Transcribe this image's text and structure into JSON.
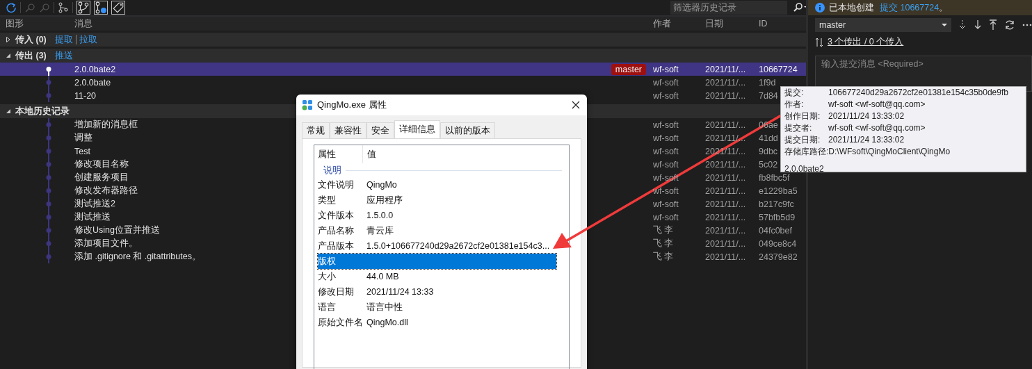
{
  "toolbar": {
    "filter": {
      "placeholder": "筛选器历史记录"
    }
  },
  "columns": [
    "图形",
    "消息",
    "作者",
    "日期",
    "ID"
  ],
  "sections": [
    {
      "title": "传入 (0)",
      "expanded": false,
      "links": [
        "提取",
        "拉取"
      ]
    },
    {
      "title": "传出 (3)",
      "expanded": true,
      "links": [
        "推送"
      ],
      "commits": [
        {
          "message": "2.0.0bate2",
          "branch": "master",
          "author": "wf-soft",
          "date": "2021/11/...",
          "id": "10667724",
          "selected": true
        },
        {
          "message": "2.0.0bate",
          "author": "wf-soft",
          "date": "2021/11/...",
          "id": "1f9d",
          "selected": false
        },
        {
          "message": "11-20",
          "author": "wf-soft",
          "date": "2021/11/...",
          "id": "7d84",
          "selected": false
        }
      ]
    },
    {
      "title": "本地历史记录",
      "expanded": true,
      "commits": [
        {
          "message": "增加新的消息框",
          "author": "wf-soft",
          "date": "2021/11/...",
          "id": "06ae",
          "selected": false
        },
        {
          "message": "调整",
          "author": "wf-soft",
          "date": "2021/11/...",
          "id": "41dd",
          "selected": false
        },
        {
          "message": "Test",
          "author": "wf-soft",
          "date": "2021/11/...",
          "id": "9dbc",
          "selected": false
        },
        {
          "message": "修改项目名称",
          "author": "wf-soft",
          "date": "2021/11/...",
          "id": "5c02",
          "selected": false
        },
        {
          "message": "创建服务项目",
          "author": "wf-soft",
          "date": "2021/11/...",
          "id": "fb8fbc5f",
          "selected": false
        },
        {
          "message": "修改发布器路径",
          "author": "wf-soft",
          "date": "2021/11/...",
          "id": "e1229ba5",
          "selected": false
        },
        {
          "message": "测试推送2",
          "author": "wf-soft",
          "date": "2021/11/...",
          "id": "b217c9fc",
          "selected": false
        },
        {
          "message": "测试推送",
          "author": "wf-soft",
          "date": "2021/11/...",
          "id": "57bfb5d9",
          "selected": false
        },
        {
          "message": "修改Using位置并推送",
          "author": "飞 李",
          "date": "2021/11/...",
          "id": "04fc0bef",
          "selected": false
        },
        {
          "message": "添加项目文件。",
          "author": "飞 李",
          "date": "2021/11/...",
          "id": "049ce8c4",
          "selected": false
        },
        {
          "message": "添加 .gitignore 和 .gitattributes。",
          "author": "飞 李",
          "date": "2021/11/...",
          "id": "24379e82",
          "selected": false
        }
      ]
    }
  ],
  "right_panel": {
    "notice": "已本地创建",
    "notice_link": "提交 10667724",
    "notice_end": "。",
    "branch": "master",
    "sync_link": "3 个传出 / 0 个传入",
    "commit_message": {
      "placeholder": "输入提交消息 <Required>"
    }
  },
  "tooltip": {
    "fields": [
      {
        "label": "提交:",
        "value": "106677240d29a2672cf2e01381e154c35b0de9fb"
      },
      {
        "label": "作者:",
        "value": "wf-soft <wf-soft@qq.com>"
      },
      {
        "label": "创作日期:",
        "value": "2021/11/24 13:33:02"
      },
      {
        "label": "提交者:",
        "value": "wf-soft <wf-soft@qq.com>"
      },
      {
        "label": "提交日期:",
        "value": "2021/11/24 13:33:02"
      },
      {
        "label": "存储库路径:",
        "value": "D:\\WFsoft\\QingMoClient\\QingMo"
      }
    ],
    "message": "2.0.0bate2"
  },
  "dialog": {
    "title": "QingMo.exe 属性",
    "tabs": [
      {
        "label": "常规",
        "selected": false
      },
      {
        "label": "兼容性",
        "selected": false
      },
      {
        "label": "安全",
        "selected": false
      },
      {
        "label": "详细信息",
        "selected": true
      },
      {
        "label": "以前的版本",
        "selected": false
      }
    ],
    "columns": [
      "属性",
      "值"
    ],
    "rows": [
      {
        "kind": "group",
        "name": "说明"
      },
      {
        "kind": "row",
        "name": "文件说明",
        "value": "QingMo",
        "selected": false
      },
      {
        "kind": "row",
        "name": "类型",
        "value": "应用程序",
        "selected": false
      },
      {
        "kind": "row",
        "name": "文件版本",
        "value": "1.5.0.0",
        "selected": false
      },
      {
        "kind": "row",
        "name": "产品名称",
        "value": "青云库",
        "selected": false
      },
      {
        "kind": "row",
        "name": "产品版本",
        "value": "1.5.0+106677240d29a2672cf2e01381e154c3...",
        "selected": false
      },
      {
        "kind": "row",
        "name": "版权",
        "selected": true
      },
      {
        "kind": "row",
        "name": "大小",
        "value": "44.0 MB",
        "selected": false
      },
      {
        "kind": "row",
        "name": "修改日期",
        "value": "2021/11/24 13:33",
        "selected": false
      },
      {
        "kind": "row",
        "name": "语言",
        "value": "语言中性",
        "selected": false
      },
      {
        "kind": "row",
        "name": "原始文件名",
        "value": "QingMo.dll",
        "selected": false
      }
    ]
  }
}
